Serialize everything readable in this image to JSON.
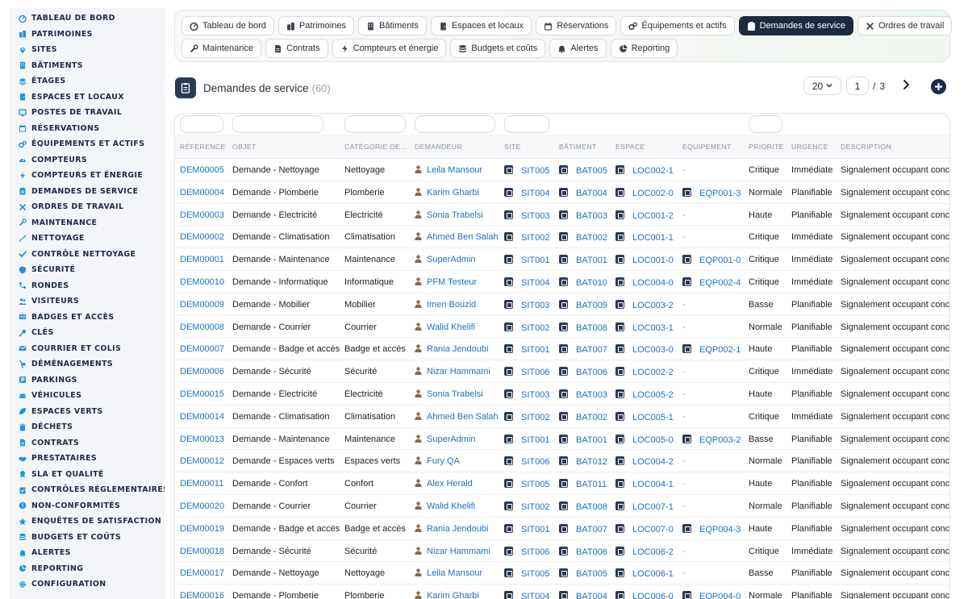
{
  "sidebar": {
    "items": [
      {
        "label": "Tableau de bord",
        "icon": "dashboard-icon"
      },
      {
        "label": "Patrimoines",
        "icon": "buildings-icon"
      },
      {
        "label": "Sites",
        "icon": "map-pin-icon"
      },
      {
        "label": "Bâtiments",
        "icon": "building-icon"
      },
      {
        "label": "Étages",
        "icon": "layers-icon"
      },
      {
        "label": "Espaces et locaux",
        "icon": "door-icon"
      },
      {
        "label": "Postes de travail",
        "icon": "monitor-icon"
      },
      {
        "label": "Réservations",
        "icon": "calendar-icon"
      },
      {
        "label": "Équipements et actifs",
        "icon": "cogs-icon"
      },
      {
        "label": "Compteurs",
        "icon": "gauge-icon"
      },
      {
        "label": "Compteurs et énergie",
        "icon": "bolt-icon"
      },
      {
        "label": "Demandes de service",
        "icon": "clipboard-icon"
      },
      {
        "label": "Ordres de travail",
        "icon": "tools-icon"
      },
      {
        "label": "Maintenance",
        "icon": "wrench-icon"
      },
      {
        "label": "Nettoyage",
        "icon": "broom-icon"
      },
      {
        "label": "Contrôle nettoyage",
        "icon": "check-icon"
      },
      {
        "label": "Sécurité",
        "icon": "shield-icon"
      },
      {
        "label": "Rondes",
        "icon": "route-icon"
      },
      {
        "label": "Visiteurs",
        "icon": "users-icon"
      },
      {
        "label": "Badges et accès",
        "icon": "id-card-icon"
      },
      {
        "label": "Clés",
        "icon": "key-icon"
      },
      {
        "label": "Courrier et colis",
        "icon": "mail-icon"
      },
      {
        "label": "Déménagements",
        "icon": "dolly-icon"
      },
      {
        "label": "Parkings",
        "icon": "parking-icon"
      },
      {
        "label": "Véhicules",
        "icon": "car-icon"
      },
      {
        "label": "Espaces verts",
        "icon": "leaf-icon"
      },
      {
        "label": "Déchets",
        "icon": "trash-icon"
      },
      {
        "label": "Contrats",
        "icon": "file-icon"
      },
      {
        "label": "Prestataires",
        "icon": "handshake-icon"
      },
      {
        "label": "SLA et qualité",
        "icon": "award-icon"
      },
      {
        "label": "Contrôles réglementaires",
        "icon": "clipboard-check-icon"
      },
      {
        "label": "Non-conformités",
        "icon": "alert-circle-icon"
      },
      {
        "label": "Enquêtes de satisfaction",
        "icon": "star-icon"
      },
      {
        "label": "Budgets et coûts",
        "icon": "coins-icon"
      },
      {
        "label": "Alertes",
        "icon": "bell-icon"
      },
      {
        "label": "Reporting",
        "icon": "chart-pie-icon"
      },
      {
        "label": "Configuration",
        "icon": "gear-icon"
      }
    ]
  },
  "tabs": {
    "row1": [
      {
        "label": "Tableau de bord",
        "icon": "dashboard-icon",
        "active": false
      },
      {
        "label": "Patrimoines",
        "icon": "buildings-icon",
        "active": false
      },
      {
        "label": "Bâtiments",
        "icon": "building-icon",
        "active": false
      },
      {
        "label": "Espaces et locaux",
        "icon": "door-icon",
        "active": false
      },
      {
        "label": "Réservations",
        "icon": "calendar-icon",
        "active": false
      },
      {
        "label": "Équipements et actifs",
        "icon": "cogs-icon",
        "active": false
      },
      {
        "label": "Demandes de service",
        "icon": "clipboard-icon",
        "active": true
      },
      {
        "label": "Ordres de travail",
        "icon": "tools-icon",
        "active": false
      }
    ],
    "row2": [
      {
        "label": "Maintenance",
        "icon": "wrench-icon",
        "active": false
      },
      {
        "label": "Contrats",
        "icon": "file-icon",
        "active": false
      },
      {
        "label": "Compteurs et énergie",
        "icon": "bolt-icon",
        "active": false
      },
      {
        "label": "Budgets et coûts",
        "icon": "coins-icon",
        "active": false
      },
      {
        "label": "Alertes",
        "icon": "bell-icon",
        "active": false
      },
      {
        "label": "Reporting",
        "icon": "chart-pie-icon",
        "active": false
      }
    ]
  },
  "header": {
    "title": "Demandes de service",
    "count": "(60)"
  },
  "pagination": {
    "per_page": "20",
    "current_page": "1",
    "separator": "/",
    "total_pages": "3"
  },
  "table": {
    "columns": [
      "RÉFÉRENCE",
      "OBJET",
      "CATÉGORIE DE…",
      "DEMANDEUR",
      "SITE",
      "BÂTIMENT",
      "ESPACE",
      "ÉQUIPEMENT",
      "PRIORITÉ",
      "URGENCE",
      "DESCRIPTION"
    ],
    "rows": [
      {
        "ref": "DEM00005",
        "objet": "Demande - Nettoyage",
        "categorie": "Nettoyage",
        "demandeur": "Leila Mansour",
        "site": "SIT005",
        "batiment": "BAT005",
        "espace": "LOC002-1",
        "equipement": "-",
        "priorite": "Critique",
        "urgence": "Immédiate",
        "description": "Signalement occupant concernant"
      },
      {
        "ref": "DEM00004",
        "objet": "Demande - Plomberie",
        "categorie": "Plomberie",
        "demandeur": "Karim Gharbi",
        "site": "SIT004",
        "batiment": "BAT004",
        "espace": "LOC002-0",
        "equipement": "EQP001-3",
        "priorite": "Normale",
        "urgence": "Planifiable",
        "description": "Signalement occupant concernant"
      },
      {
        "ref": "DEM00003",
        "objet": "Demande - Électricité",
        "categorie": "Électricité",
        "demandeur": "Sonia Trabelsi",
        "site": "SIT003",
        "batiment": "BAT003",
        "espace": "LOC001-2",
        "equipement": "-",
        "priorite": "Haute",
        "urgence": "Planifiable",
        "description": "Signalement occupant concernant"
      },
      {
        "ref": "DEM00002",
        "objet": "Demande - Climatisation",
        "categorie": "Climatisation",
        "demandeur": "Ahmed Ben Salah",
        "site": "SIT002",
        "batiment": "BAT002",
        "espace": "LOC001-1",
        "equipement": "-",
        "priorite": "Critique",
        "urgence": "Immédiate",
        "description": "Signalement occupant concernant"
      },
      {
        "ref": "DEM00001",
        "objet": "Demande - Maintenance",
        "categorie": "Maintenance",
        "demandeur": "SuperAdmin",
        "site": "SIT001",
        "batiment": "BAT001",
        "espace": "LOC001-0",
        "equipement": "EQP001-0",
        "priorite": "Critique",
        "urgence": "Immédiate",
        "description": "Signalement occupant concernant"
      },
      {
        "ref": "DEM00010",
        "objet": "Demande - Informatique",
        "categorie": "Informatique",
        "demandeur": "PFM Testeur",
        "site": "SIT004",
        "batiment": "BAT010",
        "espace": "LOC004-0",
        "equipement": "EQP002-4",
        "priorite": "Critique",
        "urgence": "Immédiate",
        "description": "Signalement occupant concernant"
      },
      {
        "ref": "DEM00009",
        "objet": "Demande - Mobilier",
        "categorie": "Mobilier",
        "demandeur": "Imen Bouzid",
        "site": "SIT003",
        "batiment": "BAT009",
        "espace": "LOC003-2",
        "equipement": "-",
        "priorite": "Basse",
        "urgence": "Planifiable",
        "description": "Signalement occupant concernant"
      },
      {
        "ref": "DEM00008",
        "objet": "Demande - Courrier",
        "categorie": "Courrier",
        "demandeur": "Walid Khelifi",
        "site": "SIT002",
        "batiment": "BAT008",
        "espace": "LOC003-1",
        "equipement": "-",
        "priorite": "Normale",
        "urgence": "Planifiable",
        "description": "Signalement occupant concernant"
      },
      {
        "ref": "DEM00007",
        "objet": "Demande - Badge et accès",
        "categorie": "Badge et accès",
        "demandeur": "Rania Jendoubi",
        "site": "SIT001",
        "batiment": "BAT007",
        "espace": "LOC003-0",
        "equipement": "EQP002-1",
        "priorite": "Haute",
        "urgence": "Planifiable",
        "description": "Signalement occupant concernant"
      },
      {
        "ref": "DEM00006",
        "objet": "Demande - Sécurité",
        "categorie": "Sécurité",
        "demandeur": "Nizar Hammami",
        "site": "SIT006",
        "batiment": "BAT006",
        "espace": "LOC002-2",
        "equipement": "-",
        "priorite": "Critique",
        "urgence": "Immédiate",
        "description": "Signalement occupant concernant"
      },
      {
        "ref": "DEM00015",
        "objet": "Demande - Électricité",
        "categorie": "Électricité",
        "demandeur": "Sonia Trabelsi",
        "site": "SIT003",
        "batiment": "BAT003",
        "espace": "LOC005-2",
        "equipement": "-",
        "priorite": "Haute",
        "urgence": "Planifiable",
        "description": "Signalement occupant concernant"
      },
      {
        "ref": "DEM00014",
        "objet": "Demande - Climatisation",
        "categorie": "Climatisation",
        "demandeur": "Ahmed Ben Salah",
        "site": "SIT002",
        "batiment": "BAT002",
        "espace": "LOC005-1",
        "equipement": "-",
        "priorite": "Critique",
        "urgence": "Immédiate",
        "description": "Signalement occupant concernant"
      },
      {
        "ref": "DEM00013",
        "objet": "Demande - Maintenance",
        "categorie": "Maintenance",
        "demandeur": "SuperAdmin",
        "site": "SIT001",
        "batiment": "BAT001",
        "espace": "LOC005-0",
        "equipement": "EQP003-2",
        "priorite": "Basse",
        "urgence": "Planifiable",
        "description": "Signalement occupant concernant"
      },
      {
        "ref": "DEM00012",
        "objet": "Demande - Espaces verts",
        "categorie": "Espaces verts",
        "demandeur": "Fury QA",
        "site": "SIT006",
        "batiment": "BAT012",
        "espace": "LOC004-2",
        "equipement": "-",
        "priorite": "Normale",
        "urgence": "Planifiable",
        "description": "Signalement occupant concernant"
      },
      {
        "ref": "DEM00011",
        "objet": "Demande - Confort",
        "categorie": "Confort",
        "demandeur": "Alex Herald",
        "site": "SIT005",
        "batiment": "BAT011",
        "espace": "LOC004-1",
        "equipement": "-",
        "priorite": "Haute",
        "urgence": "Planifiable",
        "description": "Signalement occupant concernant"
      },
      {
        "ref": "DEM00020",
        "objet": "Demande - Courrier",
        "categorie": "Courrier",
        "demandeur": "Walid Khelifi",
        "site": "SIT002",
        "batiment": "BAT008",
        "espace": "LOC007-1",
        "equipement": "-",
        "priorite": "Normale",
        "urgence": "Planifiable",
        "description": "Signalement occupant concernant"
      },
      {
        "ref": "DEM00019",
        "objet": "Demande - Badge et accès",
        "categorie": "Badge et accès",
        "demandeur": "Rania Jendoubi",
        "site": "SIT001",
        "batiment": "BAT007",
        "espace": "LOC007-0",
        "equipement": "EQP004-3",
        "priorite": "Haute",
        "urgence": "Planifiable",
        "description": "Signalement occupant concernant"
      },
      {
        "ref": "DEM00018",
        "objet": "Demande - Sécurité",
        "categorie": "Sécurité",
        "demandeur": "Nizar Hammami",
        "site": "SIT006",
        "batiment": "BAT006",
        "espace": "LOC006-2",
        "equipement": "-",
        "priorite": "Critique",
        "urgence": "Immédiate",
        "description": "Signalement occupant concernant"
      },
      {
        "ref": "DEM00017",
        "objet": "Demande - Nettoyage",
        "categorie": "Nettoyage",
        "demandeur": "Leila Mansour",
        "site": "SIT005",
        "batiment": "BAT005",
        "espace": "LOC006-1",
        "equipement": "-",
        "priorite": "Basse",
        "urgence": "Planifiable",
        "description": "Signalement occupant concernant"
      },
      {
        "ref": "DEM00016",
        "objet": "Demande - Plomberie",
        "categorie": "Plomberie",
        "demandeur": "Karim Gharbi",
        "site": "SIT004",
        "batiment": "BAT004",
        "espace": "LOC006-0",
        "equipement": "EQP004-0",
        "priorite": "Normale",
        "urgence": "Planifiable",
        "description": "Signalement occupant concernant"
      }
    ]
  },
  "colors": {
    "accent": "#1e2a3e",
    "link": "#1f6fc5",
    "sidebar_bg": "#f3f5f8",
    "sidebar_icon": "#2a8fd6",
    "add_button": "#1d2b52"
  }
}
